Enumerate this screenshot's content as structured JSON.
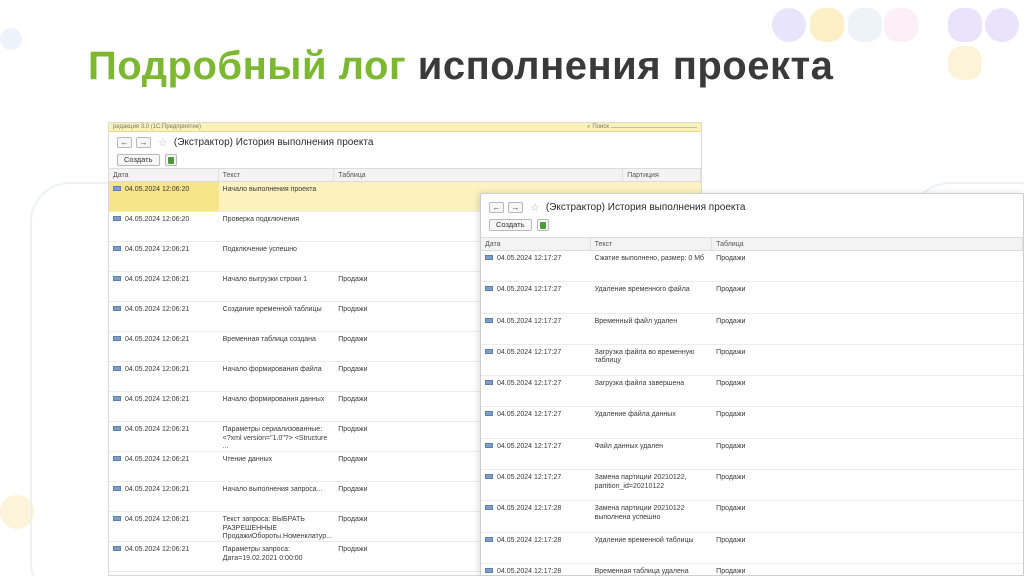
{
  "slide": {
    "title_green": "Подробный лог",
    "title_dark": "исполнения проекта"
  },
  "colors": {
    "green": "#7cb832",
    "dark": "#3a3a3a",
    "selection": "#fbf2c0",
    "topbar": "#fbf2b8"
  },
  "window1": {
    "topbar_left": "редакция 3.0 (1С:Предприятие)",
    "topbar_right": "Поиск",
    "back_icon": "arrow-left-icon",
    "forward_icon": "arrow-right-icon",
    "title": "(Экстрактор) История выполнения проекта",
    "create_label": "Создать",
    "columns": [
      "Дата",
      "Текст",
      "Таблица",
      "Партиция"
    ],
    "rows": [
      {
        "date": "04.05.2024 12:06:20",
        "text": "Начало выполнения проекта",
        "table": "",
        "selected": true
      },
      {
        "date": "04.05.2024 12:06:20",
        "text": "Проверка подключения",
        "table": ""
      },
      {
        "date": "04.05.2024 12:06:21",
        "text": "Подключение успешно",
        "table": ""
      },
      {
        "date": "04.05.2024 12:06:21",
        "text": "Начало выгрузки строки 1",
        "table": "Продажи"
      },
      {
        "date": "04.05.2024 12:06:21",
        "text": "Создание временной таблицы",
        "table": "Продажи"
      },
      {
        "date": "04.05.2024 12:06:21",
        "text": "Временная таблица создана",
        "table": "Продажи"
      },
      {
        "date": "04.05.2024 12:06:21",
        "text": "Начало формирования файла",
        "table": "Продажи"
      },
      {
        "date": "04.05.2024 12:06:21",
        "text": "Начало формирования данных",
        "table": "Продажи"
      },
      {
        "date": "04.05.2024 12:06:21",
        "text": "Параметры сериализованные: <?xml version=\"1.0\"?> <Structure ...",
        "table": "Продажи"
      },
      {
        "date": "04.05.2024 12:06:21",
        "text": "Чтение данных",
        "table": "Продажи"
      },
      {
        "date": "04.05.2024 12:06:21",
        "text": "Начало выполнения запроса...",
        "table": "Продажи"
      },
      {
        "date": "04.05.2024 12:06:21",
        "text": "Текст запроса: ВЫБРАТЬ РАЗРЕШЕННЫЕ ПродажиОбороты.Номенклатур...",
        "table": "Продажи"
      },
      {
        "date": "04.05.2024 12:06:21",
        "text": "Параметры запроса: Дата=19.02.2021 0:00:00",
        "table": "Продажи"
      }
    ]
  },
  "window2": {
    "back_icon": "arrow-left-icon",
    "forward_icon": "arrow-right-icon",
    "title": "(Экстрактор) История выполнения проекта",
    "create_label": "Создать",
    "columns": [
      "Дата",
      "Текст",
      "Таблица"
    ],
    "rows": [
      {
        "date": "04.05.2024 12:17:27",
        "text": "Сжатие выполнено, размер: 0 Мб",
        "table": "Продажи"
      },
      {
        "date": "04.05.2024 12:17:27",
        "text": "Удаление временного файла",
        "table": "Продажи"
      },
      {
        "date": "04.05.2024 12:17:27",
        "text": "Временный файл удален",
        "table": "Продажи"
      },
      {
        "date": "04.05.2024 12:17:27",
        "text": "Загрузка файла во временную таблицу",
        "table": "Продажи"
      },
      {
        "date": "04.05.2024 12:17:27",
        "text": "Загрузка файла завершена",
        "table": "Продажи"
      },
      {
        "date": "04.05.2024 12:17:27",
        "text": "Удаление файла данных",
        "table": "Продажи"
      },
      {
        "date": "04.05.2024 12:17:27",
        "text": "Файл данных удален",
        "table": "Продажи"
      },
      {
        "date": "04.05.2024 12:17:27",
        "text": "Замена партиции 20210122, partition_id=20210122",
        "table": "Продажи"
      },
      {
        "date": "04.05.2024 12:17:28",
        "text": "Замена партиции 20210122 выполнена успешно",
        "table": "Продажи"
      },
      {
        "date": "04.05.2024 12:17:28",
        "text": "Удаление временной таблицы",
        "table": "Продажи"
      },
      {
        "date": "04.05.2024 12:17:28",
        "text": "Временная таблица удалена",
        "table": "Продажи"
      }
    ]
  }
}
